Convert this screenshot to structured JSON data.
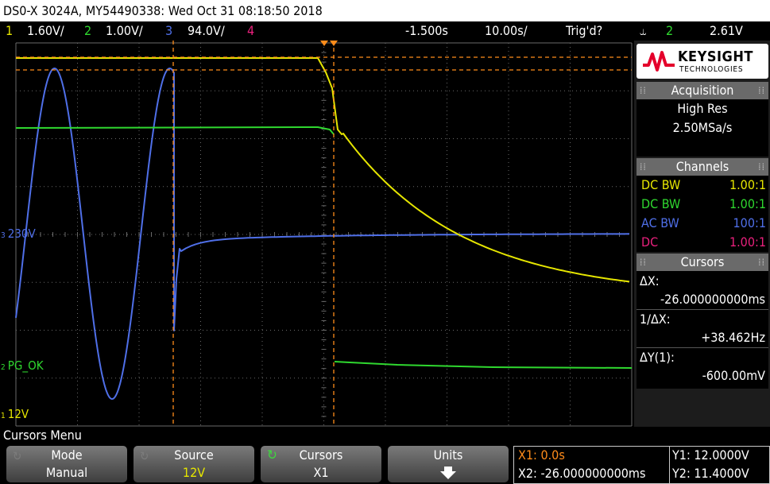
{
  "title_bar": {
    "text": "DS0-X 3024A, MY54490338: Wed Oct 31 08:18:50 2018"
  },
  "status_bar": {
    "ch1_num": "1",
    "ch1_scale": "1.60V/",
    "ch2_num": "2",
    "ch2_scale": "1.00V/",
    "ch3_num": "3",
    "ch3_scale": "94.0V/",
    "ch4_num": "4",
    "time_delay": "-1.500s",
    "time_scale": "10.00s/",
    "trigger_status": "Trig'd?",
    "trigger_icon": "falling-edge-icon",
    "trigger_channel": "2",
    "trigger_level": "2.61V"
  },
  "waveform_labels": {
    "ch3_marker": "3",
    "ch3_label": "230V",
    "ch2_marker": "2",
    "ch2_label": "PG_OK",
    "ch1_marker": "1",
    "ch1_label": "12V"
  },
  "panel": {
    "brand": "KEYSIGHT",
    "brand_sub": "TECHNOLOGIES",
    "acquisition": {
      "header": "Acquisition",
      "mode": "High Res",
      "rate": "2.50MSa/s"
    },
    "channels": {
      "header": "Channels",
      "rows": [
        {
          "coupling": "DC BW",
          "ratio": "1.00:1"
        },
        {
          "coupling": "DC BW",
          "ratio": "1.00:1"
        },
        {
          "coupling": "AC BW",
          "ratio": "100:1"
        },
        {
          "coupling": "DC",
          "ratio": "1.00:1"
        }
      ]
    },
    "cursors": {
      "header": "Cursors",
      "dx_label": "ΔX:",
      "dx_value": "-26.000000000ms",
      "inv_label": "1/ΔX:",
      "inv_value": "+38.462Hz",
      "dy_label": "ΔY(1):",
      "dy_value": "-600.00mV"
    }
  },
  "menu": {
    "title": "Cursors Menu",
    "softkeys": [
      {
        "label": "Mode",
        "value": "Manual"
      },
      {
        "label": "Source",
        "value": "12V"
      },
      {
        "label": "Cursors",
        "value": "X1"
      },
      {
        "label": "Units",
        "value": ""
      }
    ]
  },
  "readout": {
    "x1": "X1: 0.0s",
    "x2": "X2: -26.000000000ms",
    "y1": "Y1: 12.0000V",
    "y2": "Y2: 11.4000V"
  },
  "colors": {
    "ch1": "#e6e600",
    "ch2": "#2fd82f",
    "ch3": "#4f6fe8",
    "ch4": "#e8207c",
    "cursor": "#ff8c1a",
    "grid": "#6a6a6a",
    "title_bg": "#ffffff"
  },
  "waveforms": {
    "time_per_div_s": 0.01,
    "ch1_level_before_v": 12.0,
    "ch2_level_before_v": 5.0,
    "ch3_offset_v": 230
  }
}
